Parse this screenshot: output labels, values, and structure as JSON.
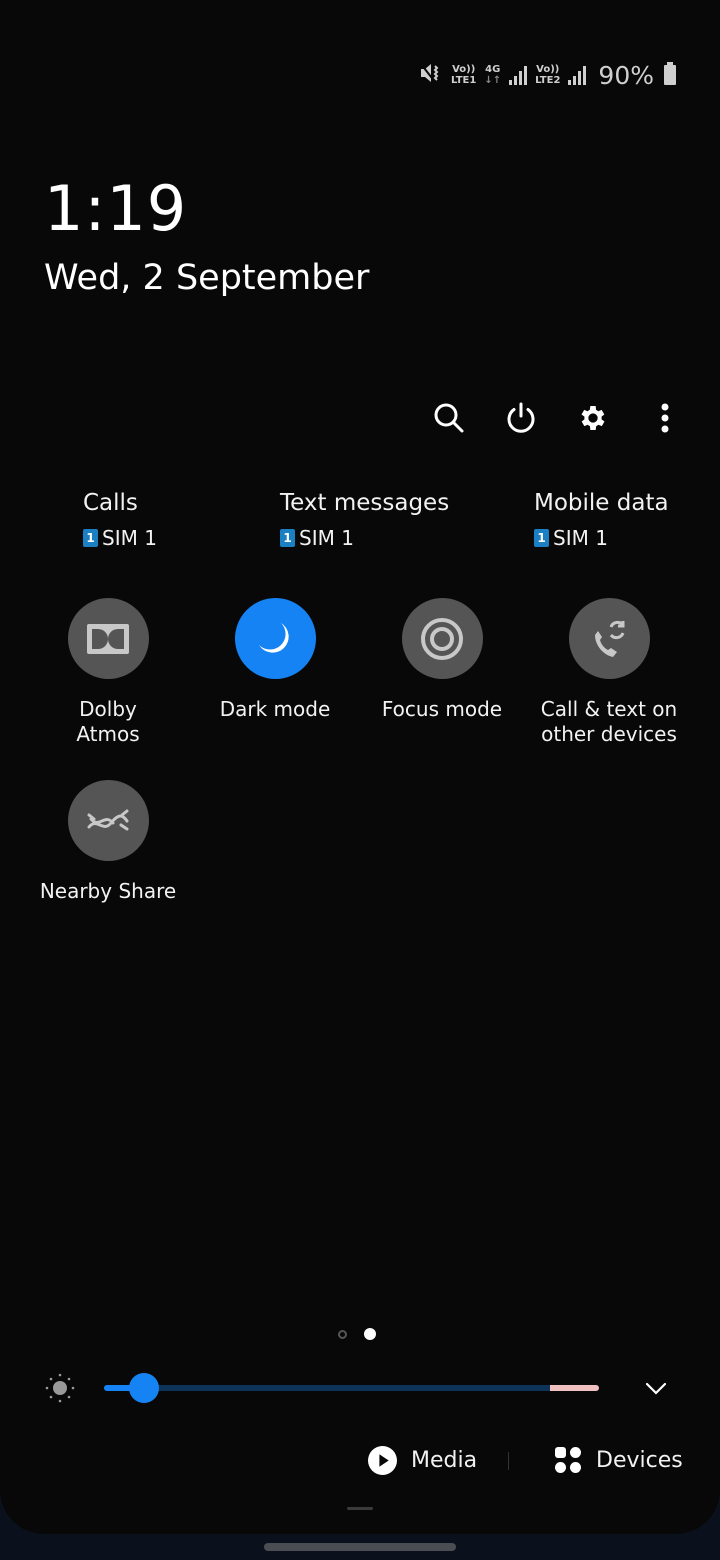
{
  "status_bar": {
    "icons": [
      "mute-vibrate-icon",
      "volte-lte1-icon",
      "4g-data-icon",
      "signal-sim1-icon",
      "volte-lte2-icon",
      "signal-sim2-icon",
      "battery-icon"
    ],
    "lte1_top": "Vo))",
    "lte1_bottom": "LTE1",
    "net_type": "4G",
    "net_arrows": "↓↑",
    "lte2_top": "Vo))",
    "lte2_bottom": "LTE2",
    "battery_percent": "90%"
  },
  "clock": {
    "time": "1:19",
    "date": "Wed, 2 September"
  },
  "toolbar": {
    "buttons": [
      {
        "name": "search",
        "icon": "search-icon"
      },
      {
        "name": "power",
        "icon": "power-icon"
      },
      {
        "name": "settings",
        "icon": "gear-icon"
      },
      {
        "name": "more",
        "icon": "more-vertical-icon"
      }
    ]
  },
  "sim_preferences": [
    {
      "title": "Calls",
      "sim_badge": "1",
      "sim_label": "SIM 1"
    },
    {
      "title": "Text messages",
      "sim_badge": "1",
      "sim_label": "SIM 1"
    },
    {
      "title": "Mobile data",
      "sim_badge": "1",
      "sim_label": "SIM 1"
    }
  ],
  "quick_tiles": [
    {
      "label": "Dolby Atmos",
      "label_lines": [
        "Dolby",
        "Atmos"
      ],
      "icon": "dolby-icon",
      "active": false
    },
    {
      "label": "Dark mode",
      "label_lines": [
        "Dark mode"
      ],
      "icon": "moon-icon",
      "active": true
    },
    {
      "label": "Focus mode",
      "label_lines": [
        "Focus mode"
      ],
      "icon": "focus-target-icon",
      "active": false
    },
    {
      "label": "Call & text on other devices",
      "label_lines": [
        "Call & text on",
        "other devices"
      ],
      "icon": "phone-sync-icon",
      "active": false
    },
    {
      "label": "Nearby Share",
      "label_lines": [
        "Nearby Share"
      ],
      "icon": "nearby-share-icon",
      "active": false
    }
  ],
  "page_indicator": {
    "pages": 2,
    "current": 2
  },
  "brightness": {
    "level_percent": 8,
    "pink_zone_start_percent": 90
  },
  "bottom_bar": {
    "media_label": "Media",
    "devices_label": "Devices"
  },
  "colors": {
    "accent": "#1683f5",
    "tile_inactive": "#555555",
    "background": "#080808",
    "sim_badge": "#1b7fc4"
  }
}
